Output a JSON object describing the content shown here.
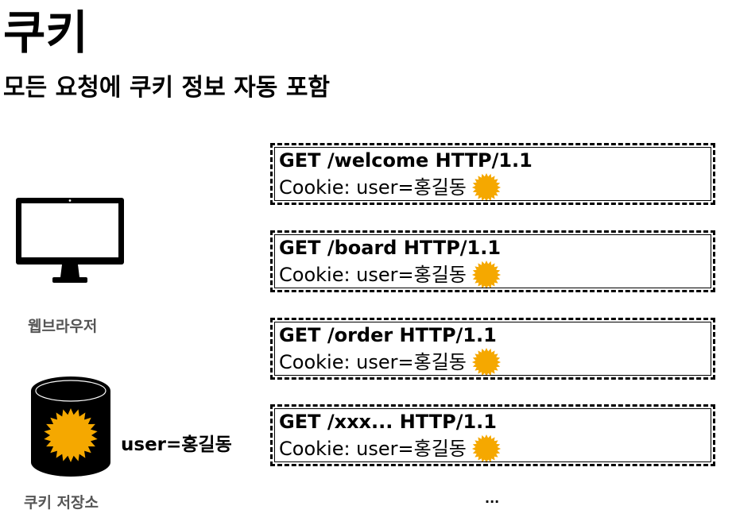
{
  "title": "쿠키",
  "subtitle": "모든 요청에 쿠키 정보 자동 포함",
  "browser": {
    "label": "웹브라우저",
    "icon": "monitor-icon"
  },
  "storage": {
    "label": "쿠키 저장소",
    "value": "user=홍길동",
    "icon": "database-cylinder-icon"
  },
  "requests": [
    {
      "request_line": "GET /welcome HTTP/1.1",
      "cookie_line": "Cookie: user=홍길동"
    },
    {
      "request_line": "GET /board HTTP/1.1",
      "cookie_line": "Cookie: user=홍길동"
    },
    {
      "request_line": "GET /order HTTP/1.1",
      "cookie_line": "Cookie: user=홍길동"
    },
    {
      "request_line": "GET /xxx... HTTP/1.1",
      "cookie_line": "Cookie: user=홍길동"
    }
  ],
  "ellipsis": "...",
  "colors": {
    "cookie_badge": "#f5a800",
    "ink": "#000000",
    "label_gray": "#555555"
  }
}
